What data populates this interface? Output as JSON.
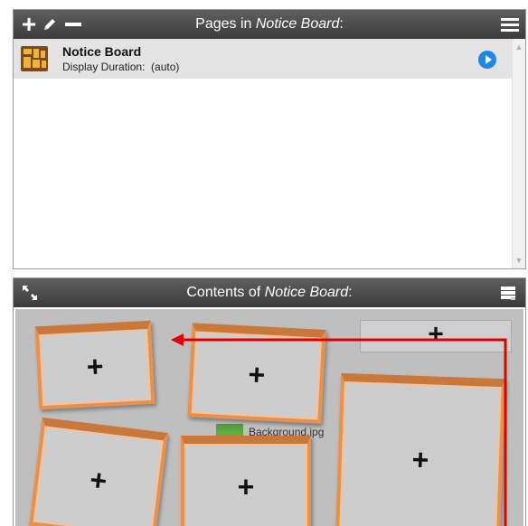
{
  "pages_panel": {
    "title_prefix": "Pages in ",
    "title_name": "Notice Board",
    "title_suffix": ":",
    "toolbar": {
      "add_icon": "plus-icon",
      "edit_icon": "pencil-icon",
      "remove_icon": "minus-icon",
      "menu_icon": "hamburger-menu-icon"
    },
    "items": [
      {
        "name": "Notice Board",
        "duration_label": "Display Duration:",
        "duration_value": "(auto)",
        "icon": "notice-board-thumbnail",
        "play_icon": "play-icon"
      }
    ]
  },
  "contents_panel": {
    "title_prefix": "Contents of ",
    "title_name": "Notice Board",
    "title_suffix": ":",
    "toolbar": {
      "resize_icon": "fullscreen-arrows-icon",
      "layout_icon": "stack-layers-icon"
    },
    "background_file": "Background.jpg",
    "frames": [
      {
        "name": "frame-top-left",
        "symbol": "+"
      },
      {
        "name": "frame-top-middle",
        "symbol": "+"
      },
      {
        "name": "frame-header",
        "symbol": "+"
      },
      {
        "name": "frame-large-right",
        "symbol": "+"
      },
      {
        "name": "frame-bottom-left",
        "symbol": "+"
      },
      {
        "name": "frame-bottom-middle",
        "symbol": "+"
      }
    ],
    "colors": {
      "frame_border": "#e8914a",
      "arrow": "#e00000",
      "canvas": "#bfbfbf",
      "titlebar": "#4a4a4a",
      "play": "#1e88e5"
    }
  }
}
